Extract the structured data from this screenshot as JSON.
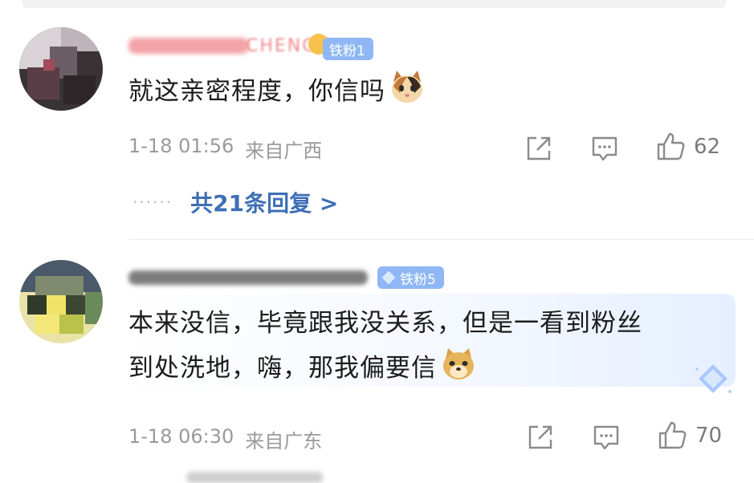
{
  "comments": [
    {
      "username_fragment": "CHENG",
      "badge": "铁粉1",
      "text": "就这亲密程度，你信吗",
      "emoji": "cat-face",
      "timestamp": "1-18 01:56",
      "location": "来自广西",
      "likes": "62",
      "replies_label": "共21条回复 >"
    },
    {
      "badge": "铁粉5",
      "text_line1": "本来没信，毕竟跟我没关系，但是一看到粉丝",
      "text_line2": "到处洗地，嗨，那我偏要信",
      "emoji": "doge-face",
      "timestamp": "1-18 06:30",
      "location": "来自广东",
      "likes": "70"
    }
  ],
  "colors": {
    "link": "#3d6fb5",
    "meta": "#9a9a9a",
    "badge": "#8fb7f5"
  }
}
